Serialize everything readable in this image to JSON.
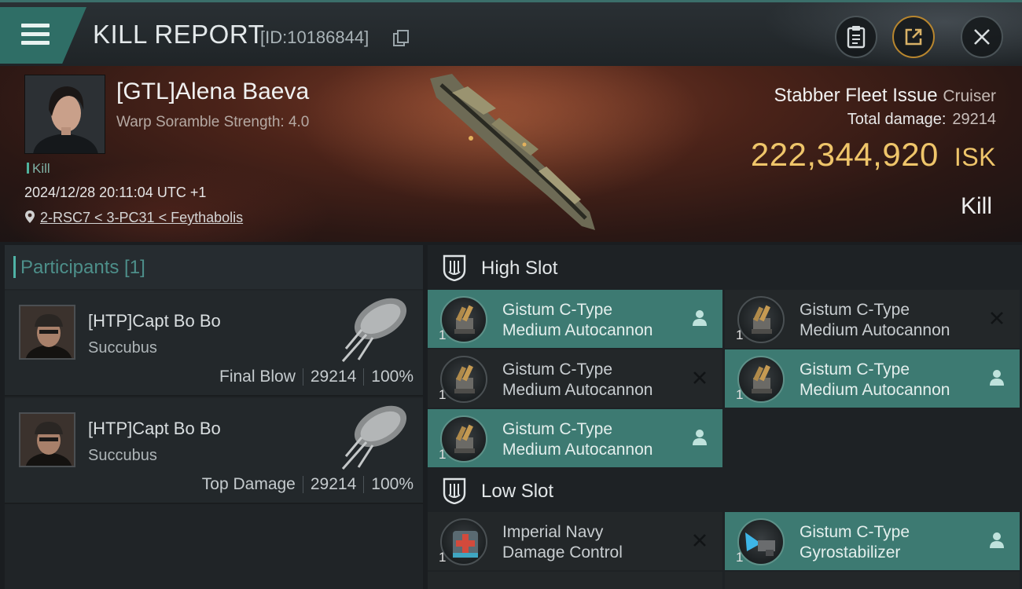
{
  "header": {
    "title": "KILL REPORT",
    "report_id": "[ID:10186844]"
  },
  "victim": {
    "name": "[GTL]Alena Baeva",
    "scram": "Warp Soramble Strength: 4.0",
    "type_tag": "Kill",
    "datetime": "2024/12/28 20:11:04 UTC +1",
    "location": "2-RSC7 < 3-PC31 < Feythabolis",
    "ship": "Stabber Fleet Issue",
    "ship_class": "Cruiser",
    "total_damage_label": "Total damage:",
    "total_damage": "29214",
    "isk_value": "222,344,920",
    "isk_unit": "ISK",
    "result": "Kill"
  },
  "participants": {
    "title": "Participants [1]",
    "items": [
      {
        "name": "[HTP]Capt Bo Bo",
        "ship": "Succubus",
        "role": "Final Blow",
        "damage": "29214",
        "percent": "100%"
      },
      {
        "name": "[HTP]Capt Bo Bo",
        "ship": "Succubus",
        "role": "Top Damage",
        "damage": "29214",
        "percent": "100%"
      }
    ]
  },
  "fitting": {
    "high_slot": {
      "label": "High Slot",
      "items": [
        {
          "line1": "Gistum C-Type",
          "line2": "Medium Autocannon",
          "qty": "1",
          "state": "dropped"
        },
        {
          "line1": "Gistum C-Type",
          "line2": "Medium Autocannon",
          "qty": "1",
          "state": "destroyed"
        },
        {
          "line1": "Gistum C-Type",
          "line2": "Medium Autocannon",
          "qty": "1",
          "state": "destroyed"
        },
        {
          "line1": "Gistum C-Type",
          "line2": "Medium Autocannon",
          "qty": "1",
          "state": "dropped"
        },
        {
          "line1": "Gistum C-Type",
          "line2": "Medium Autocannon",
          "qty": "1",
          "state": "dropped"
        }
      ]
    },
    "low_slot": {
      "label": "Low Slot",
      "items": [
        {
          "line1": "Imperial Navy",
          "line2": "Damage Control",
          "qty": "1",
          "state": "destroyed"
        },
        {
          "line1": "Gistum C-Type",
          "line2": "Gyrostabilizer",
          "qty": "1",
          "state": "dropped"
        }
      ]
    }
  },
  "colors": {
    "accent": "#3d7a72",
    "isk": "#efc56a",
    "menu": "#2f6e66"
  }
}
